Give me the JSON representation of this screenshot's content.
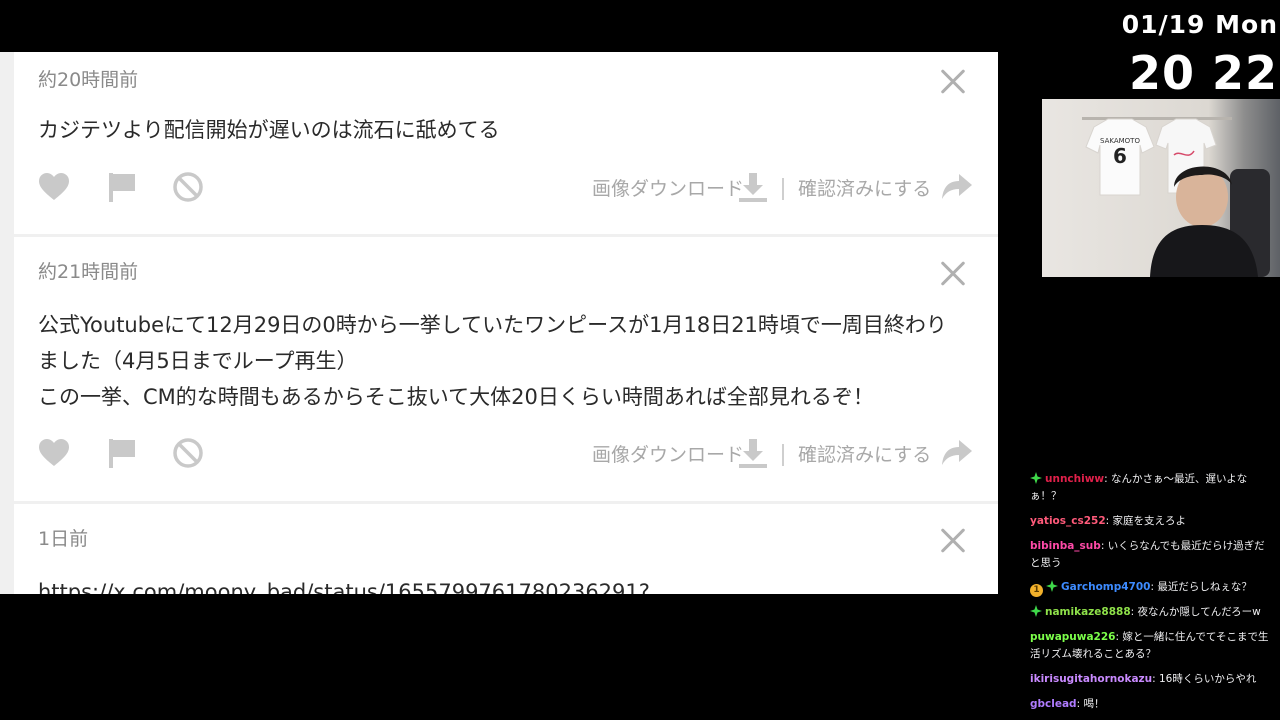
{
  "clock": {
    "date": "01/19 Mon",
    "time": "20 22"
  },
  "board": {
    "posts": [
      {
        "time": "約20時間前",
        "lines": [
          "カジテツより配信開始が遅いのは流石に舐めてる"
        ]
      },
      {
        "time": "約21時間前",
        "lines": [
          "公式Youtubeにて12月29日の0時から一挙していたワンピースが1月18日21時頃で一周目終わり",
          "ました（4月5日までループ再生）",
          "この一挙、CM的な時間もあるからそこ抜いて大体20日くらい時間あれば全部見れるぞ！"
        ]
      },
      {
        "time": "1日前",
        "lines": [
          "https://x.com/moony_bad/status/1655799761780236291?"
        ]
      }
    ],
    "actions": {
      "download": "画像ダウンロード",
      "confirm": "確認済みにする"
    }
  },
  "webcam": {
    "jersey_text": "SAKAMOTO",
    "jersey_number": "6"
  },
  "chat": {
    "messages": [
      {
        "user": "unnchiww",
        "text": ": なんかさぁ〜最近、遅いよなぁ！？",
        "color": "#e0204a",
        "star": true,
        "bits": ""
      },
      {
        "user": "yatios_cs252",
        "text": ": 家庭を支えろよ",
        "color": "#ff5a7a",
        "star": false,
        "bits": ""
      },
      {
        "user": "bibinba_sub",
        "text": ": いくらなんでも最近だらけ過ぎだと思う",
        "color": "#ff4aa8",
        "star": false,
        "bits": ""
      },
      {
        "user": "Garchomp4700",
        "text": ": 最近だらしねぇな？",
        "color": "#3d8bff",
        "star": true,
        "bits": "1"
      },
      {
        "user": "namikaze8888",
        "text": ": 夜なんか隠してんだろーw",
        "color": "#8fe24a",
        "star": true,
        "bits": ""
      },
      {
        "user": "puwapuwa226",
        "text": ": 嫁と一緒に住んでてそこまで生活リズム壊れることある？",
        "color": "#7cff4a",
        "star": false,
        "bits": ""
      },
      {
        "user": "ikirisugitahornokazu",
        "text": ": 16時くらいからやれ",
        "color": "#c98aff",
        "star": false,
        "bits": ""
      },
      {
        "user": "gbclead",
        "text": ": 喝！",
        "color": "#b07cff",
        "star": false,
        "bits": ""
      }
    ]
  }
}
